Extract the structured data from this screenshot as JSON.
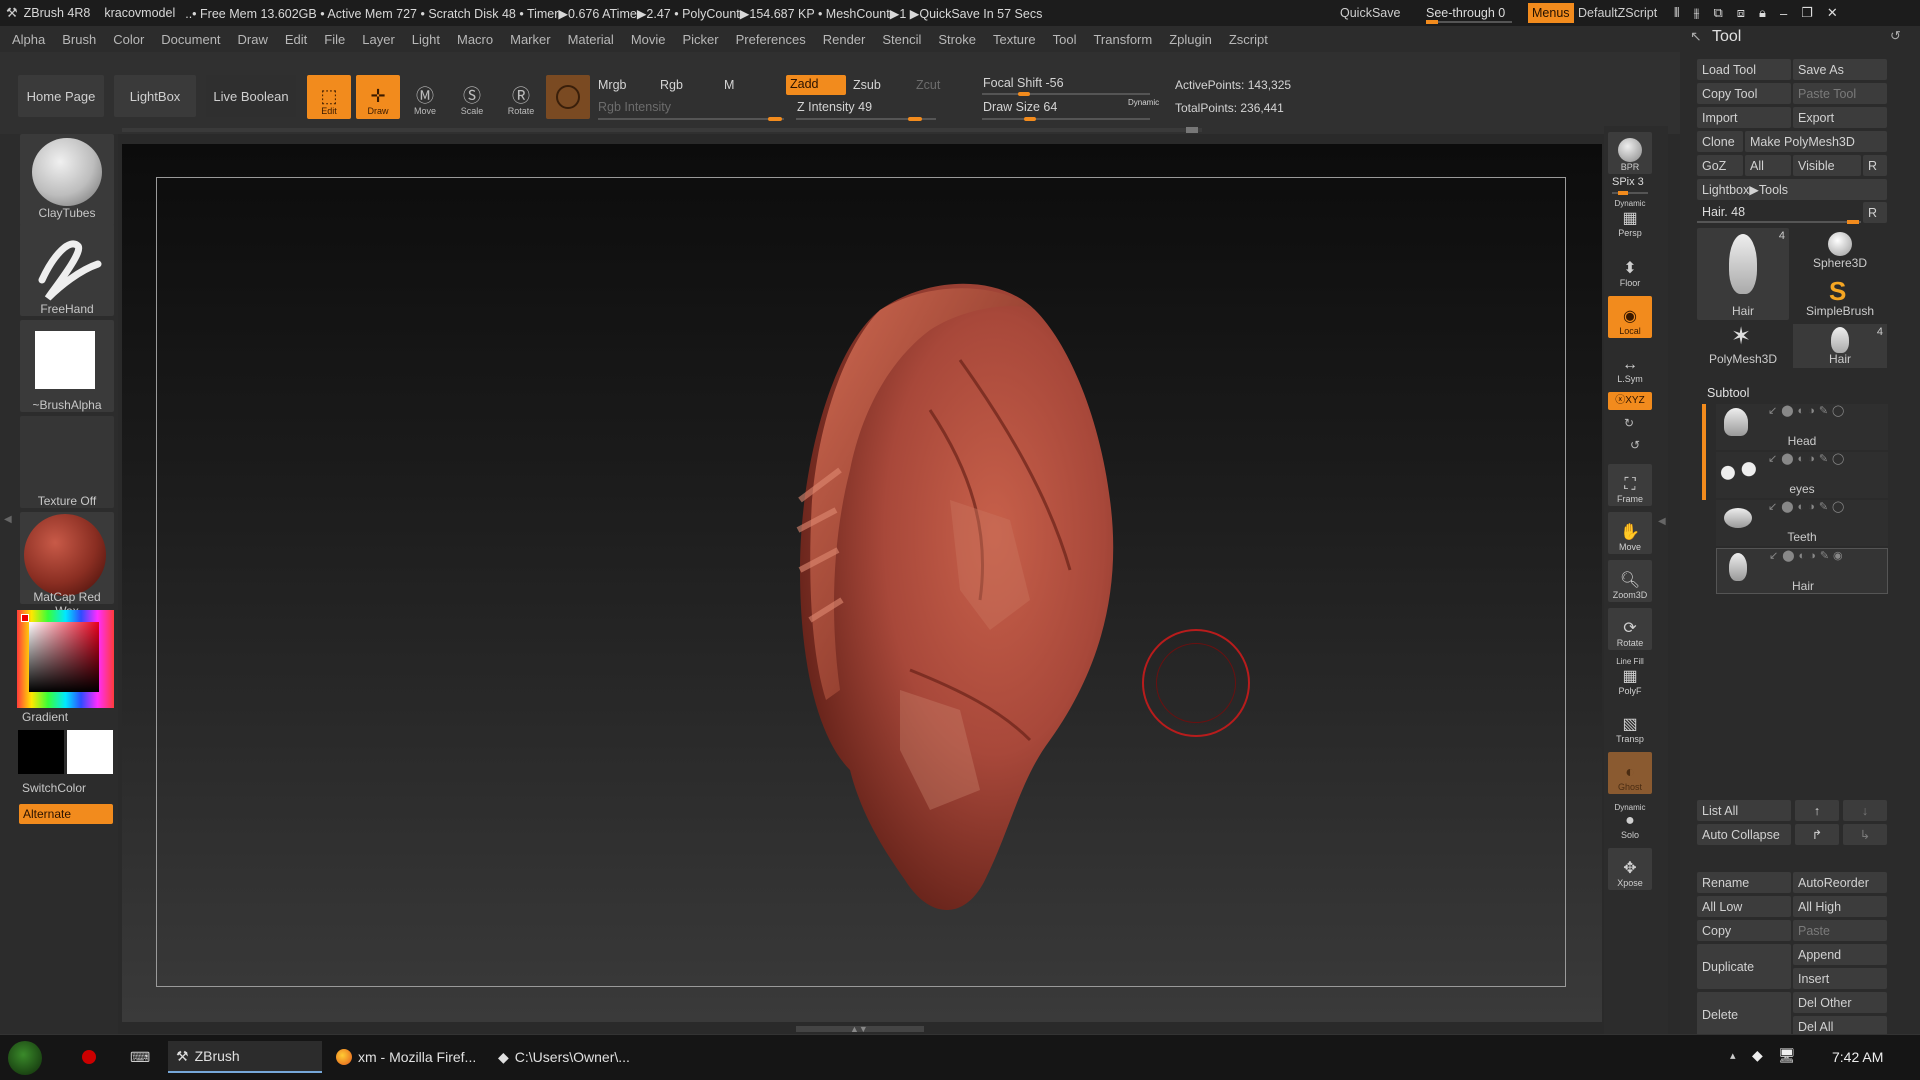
{
  "titlebar": {
    "app": "ZBrush 4R8",
    "project": "kracovmodel",
    "stats": "..• Free Mem 13.602GB • Active Mem 727 • Scratch Disk 48 •  Timer▶0.676 ATime▶2.47 • PolyCount▶154.687 KP  • MeshCount▶1  ▶QuickSave In 57 Secs",
    "quicksave": "QuickSave",
    "see_through": "See-through  0",
    "menus": "Menus",
    "script": "DefaultZScript"
  },
  "menubar": [
    "Alpha",
    "Brush",
    "Color",
    "Document",
    "Draw",
    "Edit",
    "File",
    "Layer",
    "Light",
    "Macro",
    "Marker",
    "Material",
    "Movie",
    "Picker",
    "Preferences",
    "Render",
    "Stencil",
    "Stroke",
    "Texture",
    "Tool",
    "Transform",
    "Zplugin",
    "Zscript"
  ],
  "shelf": {
    "home_page": "Home Page",
    "lightbox": "LightBox",
    "live_boolean": "Live Boolean",
    "edit": "Edit",
    "draw": "Draw",
    "move": "Move",
    "scale": "Scale",
    "rotate": "Rotate",
    "mrgb": "Mrgb",
    "rgb": "Rgb",
    "m": "M",
    "rgb_intensity": "Rgb Intensity",
    "zadd": "Zadd",
    "zsub": "Zsub",
    "zcut": "Zcut",
    "z_intensity": "Z Intensity 49",
    "focal_shift": "Focal Shift -56",
    "draw_size": "Draw Size 64",
    "dynamic": "Dynamic",
    "active_points": "ActivePoints: 143,325",
    "total_points": "TotalPoints: 236,441"
  },
  "left_palette": {
    "brush": "ClayTubes",
    "stroke": "FreeHand",
    "alpha": "~BrushAlpha",
    "texture": "Texture Off",
    "material": "MatCap Red Wax",
    "gradient": "Gradient",
    "switch_color": "SwitchColor",
    "alternate": "Alternate"
  },
  "right_column": {
    "bpr": "BPR",
    "spix": "SPix 3",
    "persp_top": "Dynamic",
    "persp": "Persp",
    "floor": "Floor",
    "local": "Local",
    "lsym": "L.Sym",
    "xyz": "ⓧXYZ",
    "frame": "Frame",
    "move": "Move",
    "zoom3d": "Zoom3D",
    "rotate": "Rotate",
    "linefill": "Line Fill",
    "polyf": "PolyF",
    "transp": "Transp",
    "ghost": "Ghost",
    "solo_top": "Dynamic",
    "solo": "Solo",
    "xpose": "Xpose"
  },
  "tool_palette": {
    "title": "Tool",
    "load_tool": "Load Tool",
    "save_as": "Save As",
    "copy_tool": "Copy Tool",
    "paste_tool": "Paste Tool",
    "import": "Import",
    "export": "Export",
    "clone": "Clone",
    "make_polymesh": "Make PolyMesh3D",
    "goz": "GoZ",
    "all": "All",
    "visible": "Visible",
    "r": "R",
    "lightbox_tools": "Lightbox▶Tools",
    "hair_slider": "Hair. 48",
    "thumbs": [
      {
        "label": "Hair",
        "count": "4"
      },
      {
        "label": "Sphere3D",
        "count": ""
      },
      {
        "label": "SimpleBrush",
        "count": ""
      },
      {
        "label": "PolyMesh3D",
        "count": ""
      },
      {
        "label": "Hair",
        "count": "4"
      }
    ],
    "subtool_header": "Subtool",
    "subtools": [
      "Head",
      "eyes",
      "Teeth",
      "Hair"
    ],
    "list_all": "List All",
    "auto_collapse": "Auto Collapse",
    "rename": "Rename",
    "auto_reorder": "AutoReorder",
    "all_low": "All Low",
    "all_high": "All High",
    "copy": "Copy",
    "paste": "Paste",
    "duplicate": "Duplicate",
    "append": "Append",
    "insert": "Insert",
    "delete": "Delete",
    "del_other": "Del Other",
    "del_all": "Del All"
  },
  "taskbar": {
    "items": [
      "ZBrush",
      "xm - Mozilla Firef...",
      "C:\\Users\\Owner\\..."
    ],
    "clock": "7:42 AM"
  },
  "colors": {
    "accent": "#f28b1d",
    "model": "#a8483a",
    "brush_cursor": "#c0201e"
  }
}
